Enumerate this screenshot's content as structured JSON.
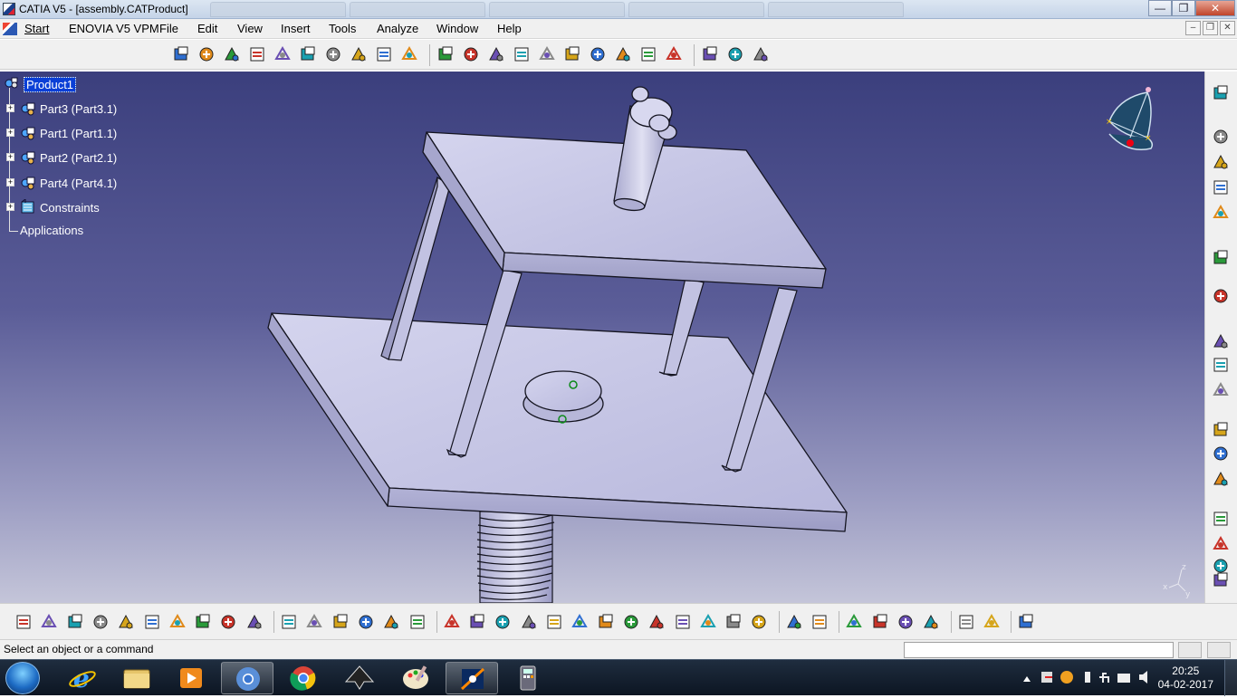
{
  "window": {
    "title": "CATIA V5 - [assembly.CATProduct]",
    "minimize_glyph": "—",
    "restore_glyph": "❐",
    "close_glyph": "✕"
  },
  "menu": {
    "items": [
      "Start",
      "ENOVIA V5 VPM",
      "File",
      "Edit",
      "View",
      "Insert",
      "Tools",
      "Analyze",
      "Window",
      "Help"
    ],
    "doc_minimize_glyph": "–",
    "doc_restore_glyph": "❐",
    "doc_close_glyph": "✕"
  },
  "tree": {
    "root": "Product1",
    "parts": [
      "Part3 (Part3.1)",
      "Part1 (Part1.1)",
      "Part2 (Part2.1)",
      "Part4 (Part4.1)"
    ],
    "constraints": "Constraints",
    "applications": "Applications"
  },
  "axis_triad": {
    "x": "x",
    "y": "y",
    "z": "z"
  },
  "status": {
    "message": "Select an object or a command",
    "command_input": ""
  },
  "taskbar": {
    "time": "20:25",
    "date": "04-02-2017"
  },
  "colors": {
    "viewport_top": "#3b3f7d",
    "viewport_bottom": "#c4c5d9",
    "part_face": "#c9c9e6",
    "part_edge": "#1a1a2a",
    "tree_selection": "#0a3fd6"
  },
  "icons": {
    "top_toolbar": [
      "sketcher-icon",
      "part-design-icon",
      "assembly-design-icon",
      "drafting-icon",
      "snap-icon",
      "pencil-icon",
      "catalog-icon",
      "bom-icon",
      "update-icon",
      "constraints-icon",
      "new-component-icon",
      "new-product-icon",
      "new-part-icon",
      "existing-component-icon",
      "replace-component-icon",
      "graph-tree-icon",
      "generate-numbering-icon",
      "selective-load-icon",
      "manage-representations-icon",
      "multi-instantiation-icon",
      "fast-multi-instantiation-icon",
      "reuse-pattern-icon",
      "compass-icon"
    ],
    "bottom_toolbar": [
      "new-icon",
      "open-icon",
      "save-icon",
      "print-icon",
      "cut-icon",
      "copy-icon",
      "paste-icon",
      "undo-icon",
      "redo-icon",
      "whats-this-icon",
      "formula-icon",
      "comment-icon",
      "design-table-icon",
      "knowledge-icon",
      "check-icon",
      "law-icon",
      "fly-icon",
      "fit-all-icon",
      "pan-icon",
      "rotate-icon",
      "zoom-in-icon",
      "zoom-out-icon",
      "normal-view-icon",
      "multi-view-icon",
      "iso-view-icon",
      "hide-show-icon",
      "swap-space-icon",
      "shading-icon",
      "measure-icon",
      "capture-icon",
      "view-mode-icon",
      "measure-between-icon",
      "measure-item-icon",
      "measure-inertia-icon",
      "update-all-icon",
      "sketch-icon",
      "catalog-icon",
      "catia-logo-icon"
    ],
    "right_toolbar": [
      "gear-icon",
      "product-view-icon",
      "component-icon",
      "component-icon",
      "component-icon",
      "select-arrow-icon",
      "move-icon",
      "fix-icon",
      "contact-icon",
      "offset-icon",
      "angle-icon",
      "fix-together-icon",
      "quick-constraint-icon",
      "flexible-icon",
      "text-annotation-icon",
      "flag-note-icon",
      "plane-icon"
    ]
  }
}
